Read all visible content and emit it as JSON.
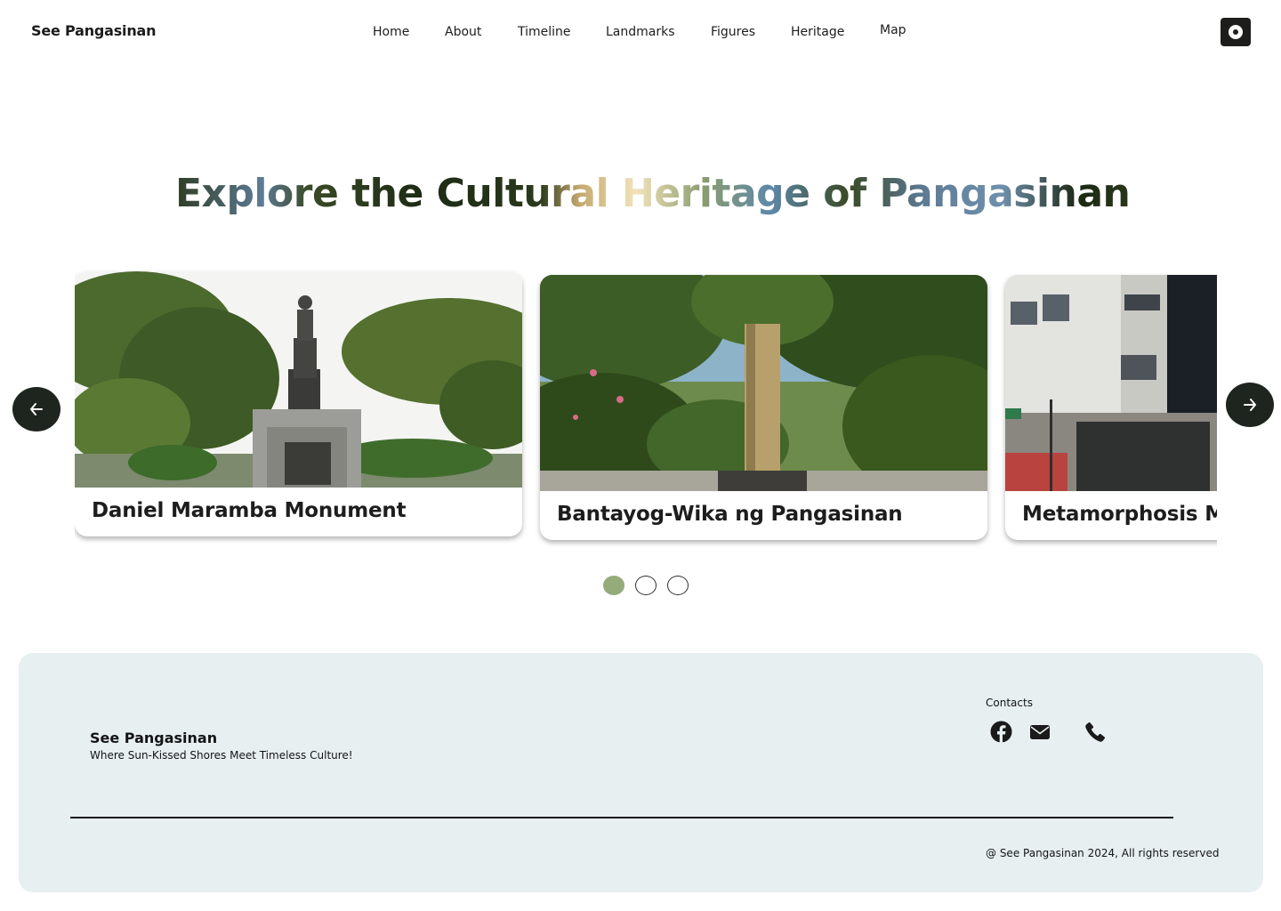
{
  "header": {
    "brand": "See Pangasinan",
    "nav": [
      "Home",
      "About",
      "Timeline",
      "Landmarks",
      "Figures",
      "Heritage",
      "Map"
    ]
  },
  "hero": {
    "title": "Explore the Cultural Heritage of Pangasinan"
  },
  "carousel": {
    "cards": [
      {
        "title": "Daniel Maramba Monument"
      },
      {
        "title": "Bantayog-Wika ng Pangasinan"
      },
      {
        "title": "Metamorphosis M"
      }
    ],
    "active_index": 0,
    "page_count": 3
  },
  "footer": {
    "brand": "See Pangasinan",
    "tagline": "Where Sun-Kissed Shores Meet Timeless Culture!",
    "contacts_label": "Contacts",
    "contact_icons": [
      "facebook-icon",
      "mail-icon",
      "phone-icon"
    ],
    "copyright": "@ See Pangasinan 2024, All rights reserved"
  },
  "colors": {
    "dark": "#1e251e",
    "accent_green": "#95ab79",
    "footer_bg": "#e7eff1"
  }
}
